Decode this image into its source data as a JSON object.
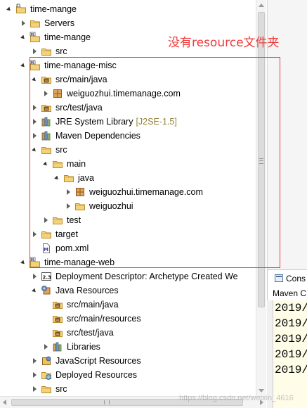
{
  "tree": {
    "rows": [
      {
        "label": "time-mange",
        "arrow": "expanded",
        "icon": "project-icon",
        "indent": 0
      },
      {
        "label": "Servers",
        "arrow": "collapsed",
        "icon": "folder-icon",
        "indent": 1
      },
      {
        "label": "time-mange",
        "arrow": "expanded",
        "icon": "maven-project-icon",
        "indent": 1
      },
      {
        "label": "src",
        "arrow": "collapsed",
        "icon": "folder-icon",
        "indent": 2
      },
      {
        "label": "time-manage-misc",
        "arrow": "expanded",
        "icon": "maven-project-icon",
        "indent": 1
      },
      {
        "label": "src/main/java",
        "arrow": "expanded",
        "icon": "source-folder-icon",
        "indent": 2
      },
      {
        "label": "weiguozhui.timemanage.com",
        "arrow": "collapsed",
        "icon": "package-icon",
        "indent": 3
      },
      {
        "label": "src/test/java",
        "arrow": "collapsed",
        "icon": "source-folder-icon",
        "indent": 2
      },
      {
        "label": "JRE System Library",
        "decor": "[J2SE-1.5]",
        "arrow": "collapsed",
        "icon": "library-icon",
        "indent": 2
      },
      {
        "label": "Maven Dependencies",
        "arrow": "collapsed",
        "icon": "library-icon",
        "indent": 2
      },
      {
        "label": "src",
        "arrow": "expanded",
        "icon": "folder-icon",
        "indent": 2
      },
      {
        "label": "main",
        "arrow": "expanded",
        "icon": "folder-icon",
        "indent": 3
      },
      {
        "label": "java",
        "arrow": "expanded",
        "icon": "folder-icon",
        "indent": 4
      },
      {
        "label": "weiguozhui.timemanage.com",
        "arrow": "collapsed",
        "icon": "package-icon",
        "indent": 5
      },
      {
        "label": "weiguozhui",
        "arrow": "collapsed",
        "icon": "folder-icon",
        "indent": 5
      },
      {
        "label": "test",
        "arrow": "collapsed",
        "icon": "folder-icon",
        "indent": 3
      },
      {
        "label": "target",
        "arrow": "collapsed",
        "icon": "folder-icon",
        "indent": 2
      },
      {
        "label": "pom.xml",
        "arrow": "none",
        "icon": "xml-file-icon",
        "indent": 2
      },
      {
        "label": "time-manage-web",
        "arrow": "expanded",
        "icon": "maven-project-icon",
        "indent": 1
      },
      {
        "label": "Deployment Descriptor: Archetype Created We",
        "arrow": "collapsed",
        "icon": "deployment-descriptor-icon",
        "indent": 2
      },
      {
        "label": "Java Resources",
        "arrow": "expanded",
        "icon": "java-resources-icon",
        "indent": 2
      },
      {
        "label": "src/main/java",
        "arrow": "none",
        "icon": "source-folder-icon",
        "indent": 3
      },
      {
        "label": "src/main/resources",
        "arrow": "none",
        "icon": "source-folder-icon",
        "indent": 3
      },
      {
        "label": "src/test/java",
        "arrow": "none",
        "icon": "source-folder-icon",
        "indent": 3
      },
      {
        "label": "Libraries",
        "arrow": "collapsed",
        "icon": "library-icon",
        "indent": 3
      },
      {
        "label": "JavaScript Resources",
        "arrow": "collapsed",
        "icon": "javascript-resources-icon",
        "indent": 2
      },
      {
        "label": "Deployed Resources",
        "arrow": "collapsed",
        "icon": "deployed-resources-icon",
        "indent": 2
      },
      {
        "label": "src",
        "arrow": "collapsed",
        "icon": "folder-icon",
        "indent": 2
      }
    ]
  },
  "annotation": {
    "text": "没有resource文件夹",
    "color": "#ef3b3b"
  },
  "console": {
    "tab_label": "Cons",
    "header": "Maven C",
    "lines": [
      "2019/",
      "2019/",
      "2019/",
      "2019/",
      "2019/"
    ]
  },
  "watermark": "https://blog.csdn.net/weixin_4616"
}
